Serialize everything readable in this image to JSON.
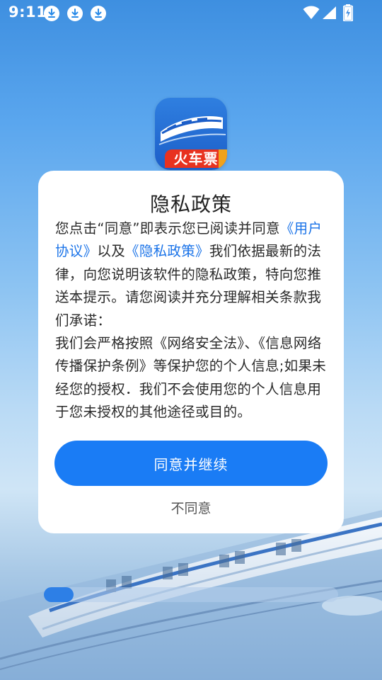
{
  "status_bar": {
    "time": "9:11",
    "notification_icons": [
      "download-icon",
      "download-icon",
      "download-icon"
    ],
    "right_icons": [
      "wifi-icon",
      "signal-icon",
      "battery-charging-icon"
    ]
  },
  "app": {
    "icon_label": "火车票",
    "icon_colors": {
      "background": "#1c5ec8",
      "banner": "#e8321f",
      "accent": "#f0a21a"
    }
  },
  "dialog": {
    "title": "隐私政策",
    "body": {
      "p1_a": "您点击“同意”即表示您已阅读并同意",
      "link_user_agreement": "《用户协议》",
      "p1_b": "以及",
      "link_privacy_policy": "《隐私政策》",
      "p1_c": "我们依据最新的法律，向您说明该软件的隐私政策，特向您推送本提示。请您阅读并充分理解相关条款我们承诺：",
      "p2": "我们会严格按照《网络安全法》、《信息网络传播保护条例》等保护您的个人信息;如果未经您的授权．我们不会使用您的个人信息用于您未授权的其他途径或目的。"
    },
    "agree_label": "同意并继续",
    "decline_label": "不同意"
  },
  "colors": {
    "accent": "#1a7cf5",
    "link": "#1a73e8"
  },
  "progress": {
    "fraction": 0.1
  }
}
